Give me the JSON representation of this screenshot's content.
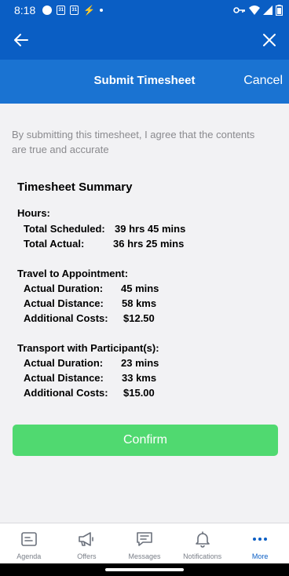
{
  "status_bar": {
    "time": "8:18",
    "cal1": "31",
    "cal2": "31"
  },
  "header": {
    "title": "Submit Timesheet",
    "cancel_label": "Cancel"
  },
  "agreement_text": "By submitting this timesheet, I agree that the contents are true and accurate",
  "summary": {
    "title": "Timesheet Summary",
    "hours": {
      "label": "Hours:",
      "scheduled_label": "Total Scheduled:",
      "scheduled_value": "39 hrs 45 mins",
      "actual_label": "Total Actual:",
      "actual_value": "36 hrs 25 mins"
    },
    "travel": {
      "label": "Travel to Appointment:",
      "duration_label": "Actual Duration:",
      "duration_value": "45 mins",
      "distance_label": "Actual Distance:",
      "distance_value": "58 kms",
      "costs_label": "Additional Costs:",
      "costs_value": "$12.50"
    },
    "transport": {
      "label": "Transport with Participant(s):",
      "duration_label": "Actual Duration:",
      "duration_value": "23 mins",
      "distance_label": "Actual Distance:",
      "distance_value": "33 kms",
      "costs_label": "Additional Costs:",
      "costs_value": "$15.00"
    }
  },
  "confirm_label": "Confirm",
  "tabs": [
    {
      "label": "Agenda",
      "icon": "agenda-icon"
    },
    {
      "label": "Offers",
      "icon": "megaphone-icon"
    },
    {
      "label": "Messages",
      "icon": "message-icon"
    },
    {
      "label": "Notifications",
      "icon": "bell-icon"
    },
    {
      "label": "More",
      "icon": "more-icon"
    }
  ],
  "colors": {
    "primary": "#0a5ec4",
    "title_bar": "#1a73d2",
    "confirm": "#50d970",
    "muted_text": "#8a8a8e"
  }
}
